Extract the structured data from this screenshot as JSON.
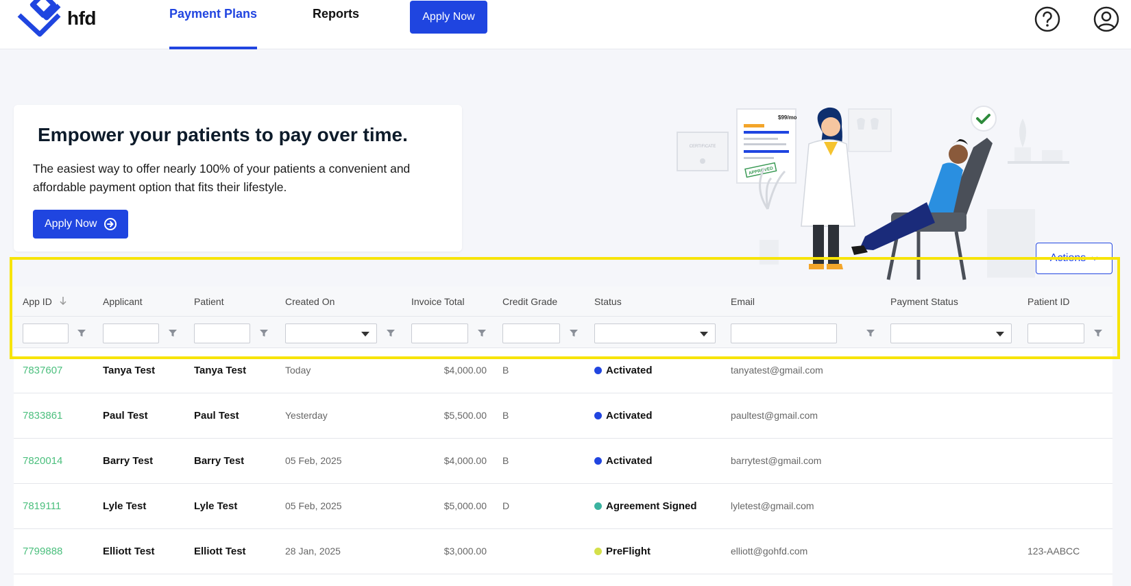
{
  "brand": {
    "name": "hfd",
    "primary": "#1f45e0",
    "link": "#4bbf7d"
  },
  "nav": {
    "tabs": [
      {
        "label": "Payment Plans",
        "active": true
      },
      {
        "label": "Reports",
        "active": false
      }
    ],
    "apply_label": "Apply Now",
    "icons": [
      "help-circle-icon",
      "user-circle-icon"
    ]
  },
  "hero": {
    "title": "Empower your patients to pay over time.",
    "text": "The easiest way to offer nearly 100% of your patients a convenient and affordable payment option that fits their lifestyle.",
    "apply_label": "Apply Now"
  },
  "illustration": {
    "certificate_label": "CERTIFICATE",
    "price_label": "$99/mo",
    "approved_label": "APPROVED"
  },
  "actions": {
    "label": "Actions"
  },
  "table": {
    "columns": [
      "App ID",
      "Applicant",
      "Patient",
      "Created On",
      "Invoice Total",
      "Credit Grade",
      "Status",
      "Email",
      "Payment Status",
      "Patient ID"
    ],
    "rows": [
      {
        "app_id": "7837607",
        "applicant": "Tanya Test",
        "patient": "Tanya Test",
        "created_on": "Today",
        "invoice_total": "$4,000.00",
        "credit_grade": "B",
        "status": "Activated",
        "status_color": "#2145e0",
        "email": "tanyatest@gmail.com",
        "payment_status": "",
        "patient_id": ""
      },
      {
        "app_id": "7833861",
        "applicant": "Paul Test",
        "patient": "Paul Test",
        "created_on": "Yesterday",
        "invoice_total": "$5,500.00",
        "credit_grade": "B",
        "status": "Activated",
        "status_color": "#2145e0",
        "email": "paultest@gmail.com",
        "payment_status": "",
        "patient_id": ""
      },
      {
        "app_id": "7820014",
        "applicant": "Barry Test",
        "patient": "Barry Test",
        "created_on": "05 Feb, 2025",
        "invoice_total": "$4,000.00",
        "credit_grade": "B",
        "status": "Activated",
        "status_color": "#2145e0",
        "email": "barrytest@gmail.com",
        "payment_status": "",
        "patient_id": ""
      },
      {
        "app_id": "7819111",
        "applicant": "Lyle Test",
        "patient": "Lyle Test",
        "created_on": "05 Feb, 2025",
        "invoice_total": "$5,000.00",
        "credit_grade": "D",
        "status": "Agreement Signed",
        "status_color": "#3bb3a0",
        "email": "lyletest@gmail.com",
        "payment_status": "",
        "patient_id": ""
      },
      {
        "app_id": "7799888",
        "applicant": "Elliott Test",
        "patient": "Elliott Test",
        "created_on": "28 Jan, 2025",
        "invoice_total": "$3,000.00",
        "credit_grade": "",
        "status": "PreFlight",
        "status_color": "#d4e04a",
        "email": "elliott@gohfd.com",
        "payment_status": "",
        "patient_id": "123-AABCC"
      }
    ]
  }
}
